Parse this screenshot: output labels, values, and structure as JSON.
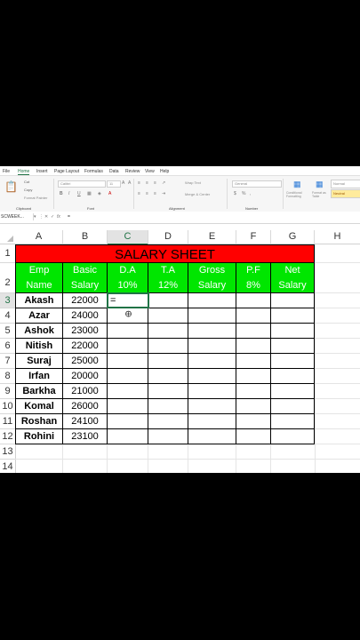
{
  "menu": {
    "tabs": [
      "File",
      "Home",
      "Insert",
      "Page Layout",
      "Formulas",
      "Data",
      "Review",
      "View",
      "Help"
    ],
    "active": "Home"
  },
  "ribbon": {
    "cut": "Cut",
    "copy": "Copy",
    "format_painter": "Format Painter",
    "font_name": "Calibri",
    "font_size": "11",
    "wrap_text": "Wrap Text",
    "merge_center": "Merge & Center",
    "number_format": "General",
    "conditional": "Conditional Formatting",
    "format_table": "Format as Table",
    "style_normal": "Normal",
    "style_neutral": "Neutral",
    "groups": {
      "clipboard": "Clipboard",
      "font": "Font",
      "alignment": "Alignment",
      "number": "Number"
    }
  },
  "formula_bar": {
    "name_box": "SCWEEK...",
    "fx": "fx",
    "content": "="
  },
  "sheet": {
    "columns": [
      "A",
      "B",
      "C",
      "D",
      "E",
      "F",
      "G",
      "H"
    ],
    "rows": [
      "1",
      "2",
      "3",
      "4",
      "5",
      "6",
      "7",
      "8",
      "9",
      "10",
      "11",
      "12",
      "13",
      "14"
    ],
    "title": "SALARY SHEET",
    "headers": [
      [
        "Emp",
        "Name"
      ],
      [
        "Basic",
        "Salary"
      ],
      [
        "D.A",
        "10%"
      ],
      [
        "T.A",
        "12%"
      ],
      [
        "Gross",
        "Salary"
      ],
      [
        "P.F",
        "8%"
      ],
      [
        "Net",
        "Salary"
      ]
    ],
    "data": [
      [
        "Akash",
        "22000"
      ],
      [
        "Azar",
        "24000"
      ],
      [
        "Ashok",
        "23000"
      ],
      [
        "Nitish",
        "22000"
      ],
      [
        "Suraj",
        "25000"
      ],
      [
        "Irfan",
        "20000"
      ],
      [
        "Barkha",
        "21000"
      ],
      [
        "Komal",
        "26000"
      ],
      [
        "Roshan",
        "24100"
      ],
      [
        "Rohini",
        "23100"
      ]
    ],
    "editing_value": "=",
    "selected_cell": "C3"
  },
  "colors": {
    "title_bg": "#ff0000",
    "header_bg": "#00e600",
    "accent": "#217346"
  }
}
